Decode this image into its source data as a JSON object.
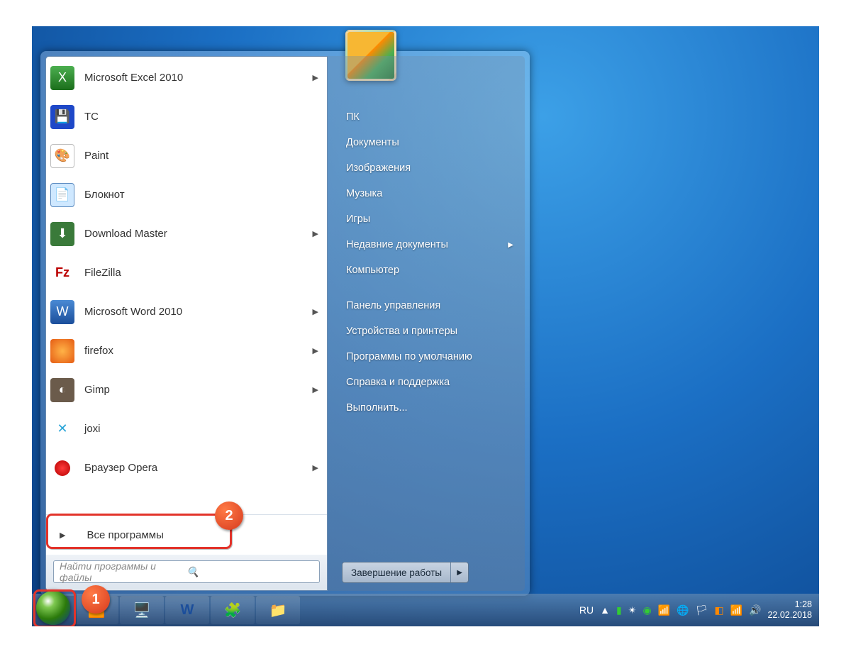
{
  "annotations": {
    "step1": "1",
    "step2": "2"
  },
  "start_menu": {
    "programs": [
      {
        "label": "Microsoft Excel 2010",
        "has_arrow": true,
        "icon": "excel-icon"
      },
      {
        "label": "TC",
        "has_arrow": false,
        "icon": "tc-icon"
      },
      {
        "label": "Paint",
        "has_arrow": false,
        "icon": "paint-icon"
      },
      {
        "label": "Блокнот",
        "has_arrow": false,
        "icon": "notepad-icon"
      },
      {
        "label": "Download Master",
        "has_arrow": true,
        "icon": "download-master-icon"
      },
      {
        "label": "FileZilla",
        "has_arrow": false,
        "icon": "filezilla-icon"
      },
      {
        "label": "Microsoft Word 2010",
        "has_arrow": true,
        "icon": "word-icon"
      },
      {
        "label": "firefox",
        "has_arrow": true,
        "icon": "firefox-icon"
      },
      {
        "label": "Gimp",
        "has_arrow": true,
        "icon": "gimp-icon"
      },
      {
        "label": "joxi",
        "has_arrow": false,
        "icon": "joxi-icon"
      },
      {
        "label": "Браузер Opera",
        "has_arrow": true,
        "icon": "opera-icon"
      }
    ],
    "all_programs": "Все программы",
    "search_placeholder": "Найти программы и файлы",
    "right_links": [
      {
        "label": "ПК"
      },
      {
        "label": "Документы"
      },
      {
        "label": "Изображения"
      },
      {
        "label": "Музыка"
      },
      {
        "label": "Игры"
      },
      {
        "label": "Недавние документы",
        "has_arrow": true
      },
      {
        "label": "Компьютер"
      },
      {
        "label": "Панель управления"
      },
      {
        "label": "Устройства и принтеры"
      },
      {
        "label": "Программы по умолчанию"
      },
      {
        "label": "Справка и поддержка"
      },
      {
        "label": "Выполнить..."
      }
    ],
    "shutdown_label": "Завершение работы"
  },
  "taskbar": {
    "language": "RU",
    "time": "1:28",
    "date": "22.02.2018"
  }
}
